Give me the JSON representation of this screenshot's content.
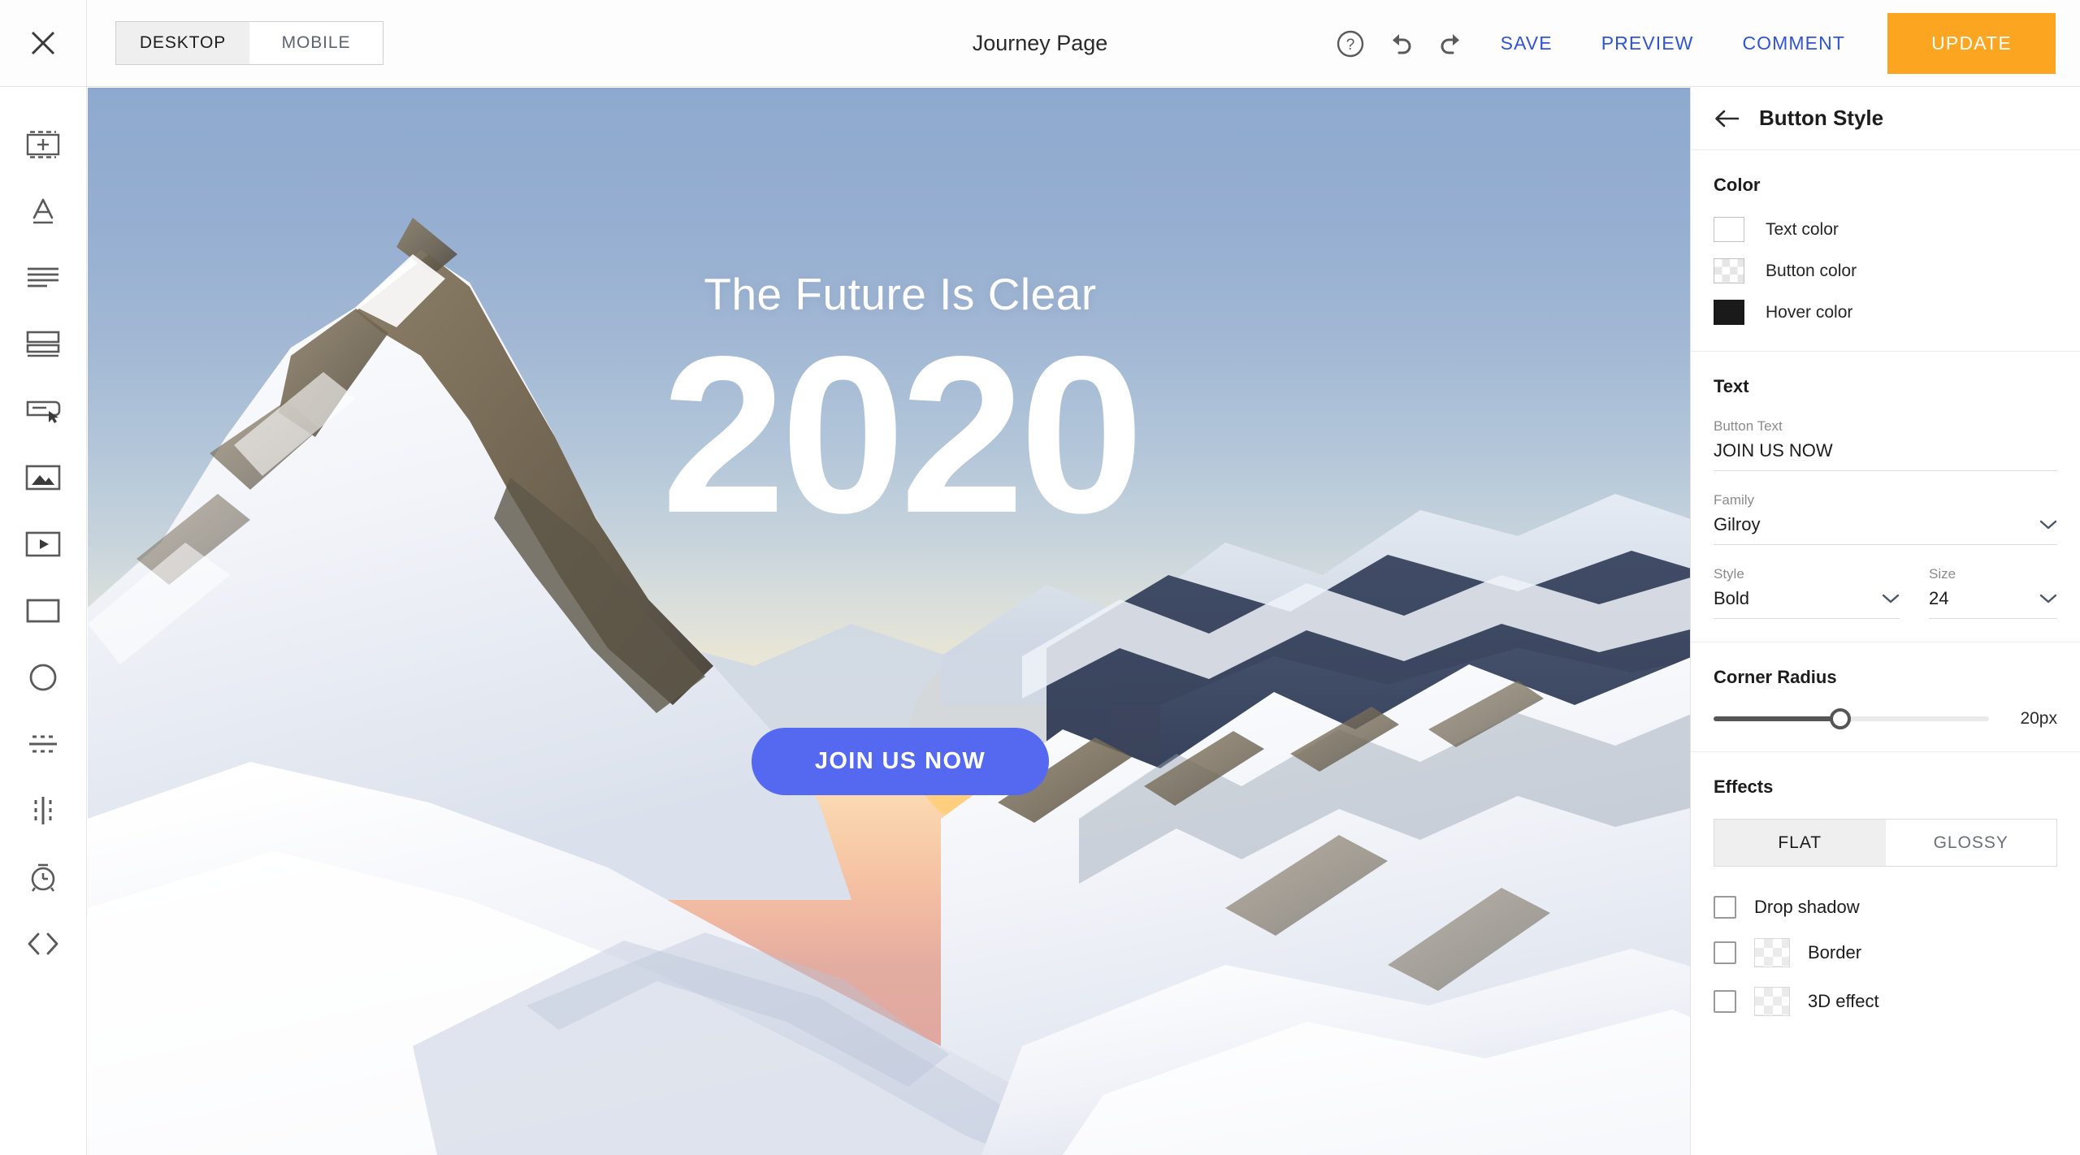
{
  "topbar": {
    "close_icon": "close-icon",
    "device_tabs": [
      {
        "label": "DESKTOP",
        "active": true
      },
      {
        "label": "MOBILE",
        "active": false
      }
    ],
    "page_title": "Journey Page",
    "help_icon": "help-circle-icon",
    "undo_icon": "undo-icon",
    "redo_icon": "redo-icon",
    "save_label": "SAVE",
    "preview_label": "PREVIEW",
    "comment_label": "COMMENT",
    "update_label": "UPDATE",
    "accent_link_color": "#2f54d8",
    "update_button_color": "#fba521"
  },
  "left_rail": {
    "items": [
      {
        "icon": "add-section-icon",
        "name": "sidebar-item-add-section"
      },
      {
        "icon": "text-icon",
        "name": "sidebar-item-text"
      },
      {
        "icon": "paragraph-icon",
        "name": "sidebar-item-paragraph"
      },
      {
        "icon": "rows-icon",
        "name": "sidebar-item-rows"
      },
      {
        "icon": "button-icon",
        "name": "sidebar-item-button"
      },
      {
        "icon": "image-icon",
        "name": "sidebar-item-image"
      },
      {
        "icon": "video-icon",
        "name": "sidebar-item-video"
      },
      {
        "icon": "rectangle-icon",
        "name": "sidebar-item-rectangle"
      },
      {
        "icon": "circle-icon",
        "name": "sidebar-item-circle"
      },
      {
        "icon": "horizontal-divider-icon",
        "name": "sidebar-item-horizontal-divider"
      },
      {
        "icon": "vertical-divider-icon",
        "name": "sidebar-item-vertical-divider"
      },
      {
        "icon": "timer-icon",
        "name": "sidebar-item-timer"
      },
      {
        "icon": "code-icon",
        "name": "sidebar-item-code"
      }
    ]
  },
  "canvas": {
    "hero_heading": "The Future Is Clear",
    "hero_year": "2020",
    "hero_cta_label": "JOIN US NOW",
    "hero_cta_color": "#5468f0",
    "hero_text_color": "#ffffff",
    "sky_top_color": "#8ea9cf",
    "sky_horizon_color": "#fbe7c4",
    "sun_color": "#ffcf78"
  },
  "panel": {
    "title": "Button Style",
    "back_icon": "back-arrow-icon",
    "color_section": {
      "title": "Color",
      "rows": [
        {
          "label": "Text color",
          "swatch": "white",
          "value": "#ffffff"
        },
        {
          "label": "Button color",
          "swatch": "transparent",
          "value": "transparent"
        },
        {
          "label": "Hover color",
          "swatch": "black",
          "value": "#1a1a1a"
        }
      ]
    },
    "text_section": {
      "title": "Text",
      "button_text_label": "Button Text",
      "button_text_value": "JOIN US NOW",
      "family_label": "Family",
      "family_value": "Gilroy",
      "style_label": "Style",
      "style_value": "Bold",
      "size_label": "Size",
      "size_value": "24"
    },
    "corner_radius_section": {
      "title": "Corner Radius",
      "value_label": "20px",
      "percent": 46
    },
    "effects_section": {
      "title": "Effects",
      "tabs": [
        {
          "label": "FLAT",
          "active": true
        },
        {
          "label": "GLOSSY",
          "active": false
        }
      ],
      "checkboxes": [
        {
          "label": "Drop shadow",
          "checked": false,
          "has_swatch": false
        },
        {
          "label": "Border",
          "checked": false,
          "has_swatch": true
        },
        {
          "label": "3D effect",
          "checked": false,
          "has_swatch": true
        }
      ]
    }
  }
}
